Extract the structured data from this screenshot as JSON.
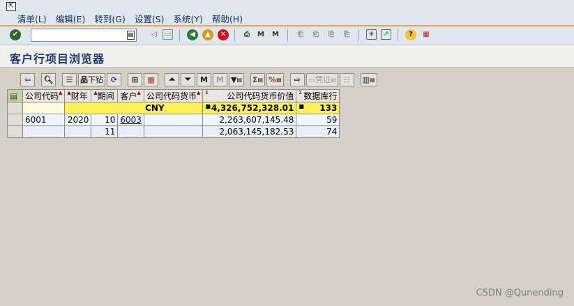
{
  "menu": {
    "items": [
      "清单(L)",
      "编辑(E)",
      "转到(G)",
      "设置(S)",
      "系统(Y)",
      "帮助(H)"
    ]
  },
  "toolbar": {
    "command_value": ""
  },
  "page": {
    "title": "客户行项目浏览器"
  },
  "alv_toolbar": {
    "drilldown_label": "下钻",
    "voucher_label": "凭证"
  },
  "grid": {
    "columns": [
      "公司代码",
      "财年",
      "期间",
      "客户",
      "公司代码货币",
      "公司代码货币价值",
      "数据库行"
    ],
    "sum_row": {
      "currency": "CNY",
      "value": "4,326,752,328.01",
      "count": "133"
    },
    "rows": [
      {
        "company": "6001",
        "year": "2020",
        "period": "10",
        "customer": "6003",
        "currency": "",
        "value": "2,263,607,145.48",
        "count": "59"
      },
      {
        "company": "",
        "year": "",
        "period": "11",
        "customer": "",
        "currency": "",
        "value": "2,063,145,182.53",
        "count": "74"
      }
    ]
  },
  "watermark": "CSDN @Qunending",
  "colors": {
    "accent": "#e8a84a",
    "sum_row": "#fff15c",
    "title": "#1c3565"
  }
}
